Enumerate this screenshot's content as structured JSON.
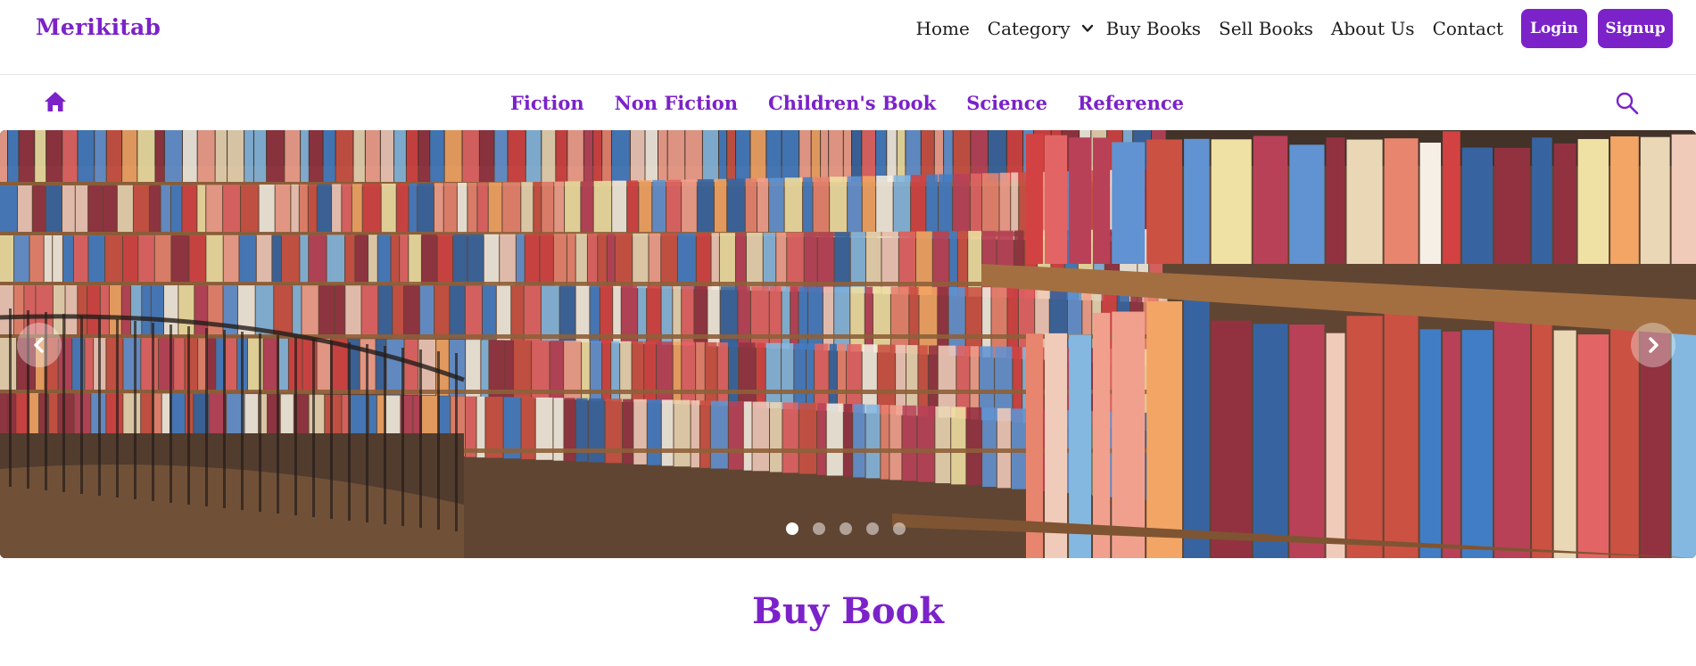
{
  "brand": {
    "name": "Merikitab"
  },
  "nav": {
    "home": "Home",
    "category": "Category",
    "buy_books": "Buy Books",
    "sell_books": "Sell Books",
    "about": "About Us",
    "contact": "Contact",
    "login": "Login",
    "signup": "Signup"
  },
  "categories": [
    "Fiction",
    "Non Fiction",
    "Children's Book",
    "Science",
    "Reference"
  ],
  "carousel": {
    "slide_count": 5,
    "active_slide": 1
  },
  "section": {
    "title": "Buy Book"
  },
  "colors": {
    "accent": "#7b22c9"
  },
  "icons": [
    "home-icon",
    "search-icon",
    "chevron-down-icon",
    "chevron-left-icon",
    "chevron-right-icon"
  ]
}
